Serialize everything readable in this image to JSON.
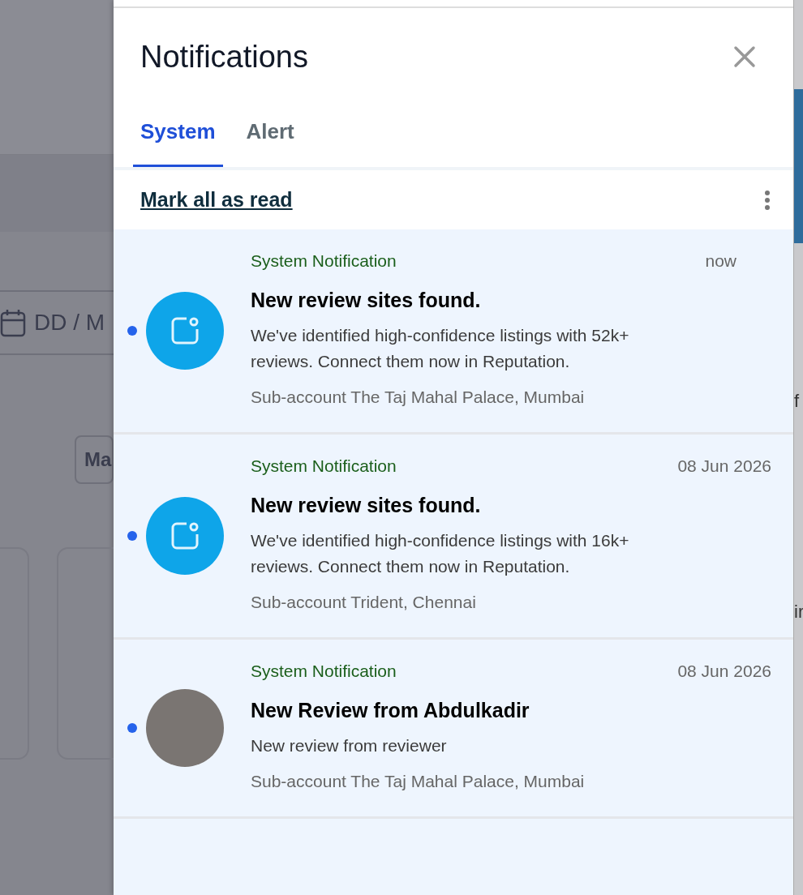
{
  "background": {
    "date_field": "DD / M",
    "button": "Ma",
    "edge_texts": [
      "f",
      "ir"
    ]
  },
  "header": {
    "title": "Notifications"
  },
  "tabs": [
    {
      "label": "System",
      "selected": true
    },
    {
      "label": "Alert",
      "selected": false
    }
  ],
  "mark_all_read": "Mark all as read",
  "notifications": [
    {
      "kind": "app",
      "unread": true,
      "category": "System Notification",
      "time": "now",
      "title": "New review sites found.",
      "body": "We've identified high-confidence listings with 52k+ reviews. Connect them now in Reputation.",
      "account": "Sub-account The Taj Mahal Palace, Mumbai"
    },
    {
      "kind": "app",
      "unread": true,
      "category": "System Notification",
      "time": "08 Jun 2026",
      "title": "New review sites found.",
      "body": "We've identified high-confidence listings with 16k+ reviews. Connect them now in Reputation.",
      "account": "Sub-account Trident, Chennai"
    },
    {
      "kind": "photo",
      "unread": true,
      "category": "System Notification",
      "time": "08 Jun 2026",
      "title": "New Review from Abdulkadir",
      "body": "New review from reviewer",
      "account": "Sub-account The Taj Mahal Palace, Mumbai"
    }
  ]
}
